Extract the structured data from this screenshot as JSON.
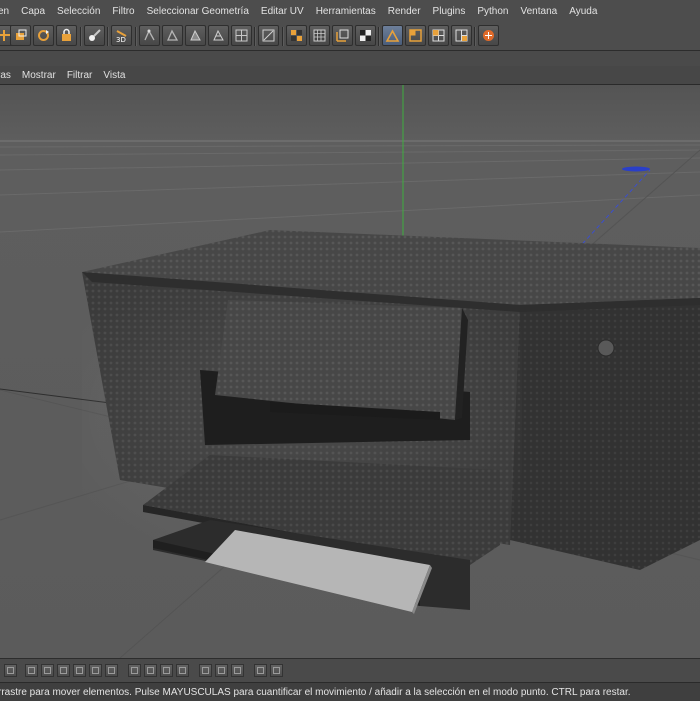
{
  "menubar": {
    "items": [
      "en",
      "Capa",
      "Selección",
      "Filtro",
      "Seleccionar Geometría",
      "Editar UV",
      "Herramientas",
      "Render",
      "Plugins",
      "Python",
      "Ventana",
      "Ayuda"
    ]
  },
  "toolbar": {
    "icons": [
      "move-tool-icon",
      "scale-tool-icon",
      "rotate-tool-icon",
      "live-selection-icon",
      "brush-tool-icon",
      "3d-paint-icon",
      "uv-points-icon",
      "uv-edges-icon",
      "uv-polygons-icon",
      "uv-mesh-icon",
      "texture-view-icon",
      "checker-icon",
      "uv-checker-icon",
      "uv-grid-icon",
      "uv-checker-alt-icon",
      "polygon-mode-icon",
      "edge-mode-icon",
      "point-mode-icon",
      "layout-grid-icon",
      "render-icon"
    ],
    "label_3d": "3D"
  },
  "viewmenu": {
    "items": [
      "ras",
      "Mostrar",
      "Filtrar",
      "Vista"
    ]
  },
  "status": {
    "text": "rrastre para mover elementos. Pulse MAYUSCULAS para cuantificar el movimiento / añadir a la selección en el modo punto. CTRL para restar."
  },
  "colors": {
    "background": "#5b5b5b",
    "axis_x": "#c33b3b",
    "axis_y": "#3fae3f",
    "axis_z": "#3b4fd0",
    "accent_orange": "#e8a13a"
  }
}
